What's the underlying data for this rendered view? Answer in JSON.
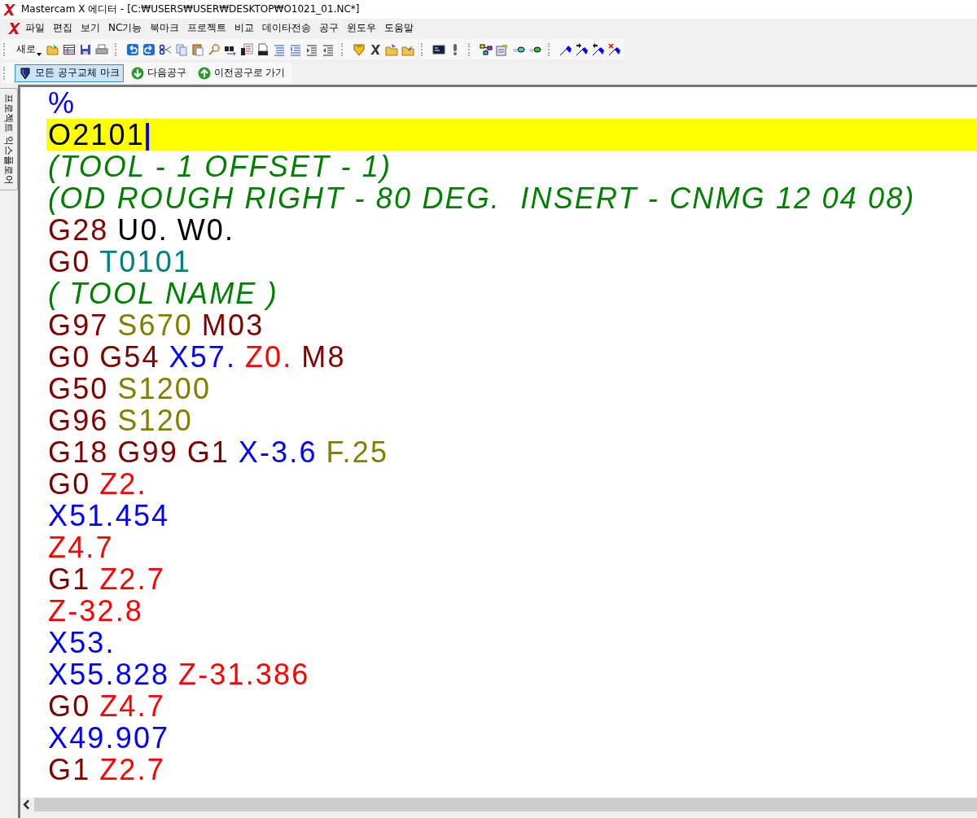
{
  "window": {
    "title": "Mastercam X 에디터 - [C:₩USERS₩USER₩DESKTOP₩O1021_01.NC*]"
  },
  "menu": [
    "파일",
    "편집",
    "보기",
    "NC기능",
    "북마크",
    "프로젝트",
    "비교",
    "데이타전송",
    "공구",
    "윈도우",
    "도움말"
  ],
  "toolbar": {
    "new_button": "새로"
  },
  "tool_change_bar": [
    {
      "label": "모든 공구교체 마크",
      "selected": true,
      "kind": "mark"
    },
    {
      "label": "다음공구",
      "selected": false,
      "kind": "next"
    },
    {
      "label": "이전공구로 가기",
      "selected": false,
      "kind": "prev"
    }
  ],
  "side_tab": "프로젝트 익스플로어",
  "editor": {
    "lines": [
      {
        "selected": false,
        "tokens": [
          {
            "text": "%",
            "kind": "code",
            "color": "#0000ff"
          }
        ]
      },
      {
        "selected": true,
        "tokens": [
          {
            "text": "O2101",
            "kind": "code"
          }
        ]
      },
      {
        "selected": false,
        "tokens": [
          {
            "text": "(TOOL - 1 OFFSET - 1)",
            "kind": "comment",
            "color": "#008000"
          }
        ]
      },
      {
        "selected": false,
        "tokens": [
          {
            "text": "(OD ROUGH RIGHT - 80 DEG.  INSERT - CNMG 12 04 08)",
            "kind": "comment",
            "color": "#008000"
          }
        ]
      },
      {
        "selected": false,
        "tokens": [
          {
            "text": "G28",
            "kind": "code",
            "color": "#800000"
          },
          {
            "text": "U0.",
            "kind": "code",
            "color": "#000000"
          },
          {
            "text": "W0.",
            "kind": "code",
            "color": "#000000"
          }
        ]
      },
      {
        "selected": false,
        "tokens": [
          {
            "text": "G0",
            "kind": "code",
            "color": "#800000"
          },
          {
            "text": "T0101",
            "kind": "code",
            "color": "#008080"
          }
        ]
      },
      {
        "selected": false,
        "tokens": [
          {
            "text": "( TOOL NAME )",
            "kind": "comment",
            "color": "#008000"
          }
        ]
      },
      {
        "selected": false,
        "tokens": [
          {
            "text": "G97",
            "kind": "code",
            "color": "#800000"
          },
          {
            "text": "S670",
            "kind": "code",
            "color": "#808000"
          },
          {
            "text": "M03",
            "kind": "code",
            "color": "#800000"
          }
        ]
      },
      {
        "selected": false,
        "tokens": [
          {
            "text": "G0",
            "kind": "code",
            "color": "#800000"
          },
          {
            "text": "G54",
            "kind": "code",
            "color": "#800000"
          },
          {
            "text": "X57.",
            "kind": "code",
            "color": "#0000ff"
          },
          {
            "text": "Z0.",
            "kind": "code",
            "color": "#ff0000"
          },
          {
            "text": "M8",
            "kind": "code",
            "color": "#800000"
          }
        ]
      },
      {
        "selected": false,
        "tokens": [
          {
            "text": "G50",
            "kind": "code",
            "color": "#800000"
          },
          {
            "text": "S1200",
            "kind": "code",
            "color": "#808000"
          }
        ]
      },
      {
        "selected": false,
        "tokens": [
          {
            "text": "G96",
            "kind": "code",
            "color": "#800000"
          },
          {
            "text": "S120",
            "kind": "code",
            "color": "#808000"
          }
        ]
      },
      {
        "selected": false,
        "tokens": [
          {
            "text": "G18",
            "kind": "code",
            "color": "#800000"
          },
          {
            "text": "G99",
            "kind": "code",
            "color": "#800000"
          },
          {
            "text": "G1",
            "kind": "code",
            "color": "#800000"
          },
          {
            "text": "X-3.6",
            "kind": "code",
            "color": "#0000ff"
          },
          {
            "text": "F.25",
            "kind": "code",
            "color": "#808000"
          }
        ]
      },
      {
        "selected": false,
        "tokens": [
          {
            "text": "G0",
            "kind": "code",
            "color": "#800000"
          },
          {
            "text": "Z2.",
            "kind": "code",
            "color": "#ff0000"
          }
        ]
      },
      {
        "selected": false,
        "tokens": [
          {
            "text": "X51.454",
            "kind": "code",
            "color": "#0000ff"
          }
        ]
      },
      {
        "selected": false,
        "tokens": [
          {
            "text": "Z4.7",
            "kind": "code",
            "color": "#ff0000"
          }
        ]
      },
      {
        "selected": false,
        "tokens": [
          {
            "text": "G1",
            "kind": "code",
            "color": "#800000"
          },
          {
            "text": "Z2.7",
            "kind": "code",
            "color": "#ff0000"
          }
        ]
      },
      {
        "selected": false,
        "tokens": [
          {
            "text": "Z-32.8",
            "kind": "code",
            "color": "#ff0000"
          }
        ]
      },
      {
        "selected": false,
        "tokens": [
          {
            "text": "X53.",
            "kind": "code",
            "color": "#0000ff"
          }
        ]
      },
      {
        "selected": false,
        "tokens": [
          {
            "text": "X55.828",
            "kind": "code",
            "color": "#0000ff"
          },
          {
            "text": "Z-31.386",
            "kind": "code",
            "color": "#ff0000"
          }
        ]
      },
      {
        "selected": false,
        "tokens": [
          {
            "text": "G0",
            "kind": "code",
            "color": "#800000"
          },
          {
            "text": "Z4.7",
            "kind": "code",
            "color": "#ff0000"
          }
        ]
      },
      {
        "selected": false,
        "tokens": [
          {
            "text": "X49.907",
            "kind": "code",
            "color": "#0000ff"
          }
        ]
      },
      {
        "selected": false,
        "tokens": [
          {
            "text": "G1",
            "kind": "code",
            "color": "#800000"
          },
          {
            "text": "Z2.7",
            "kind": "code",
            "color": "#ff0000"
          }
        ]
      }
    ]
  }
}
